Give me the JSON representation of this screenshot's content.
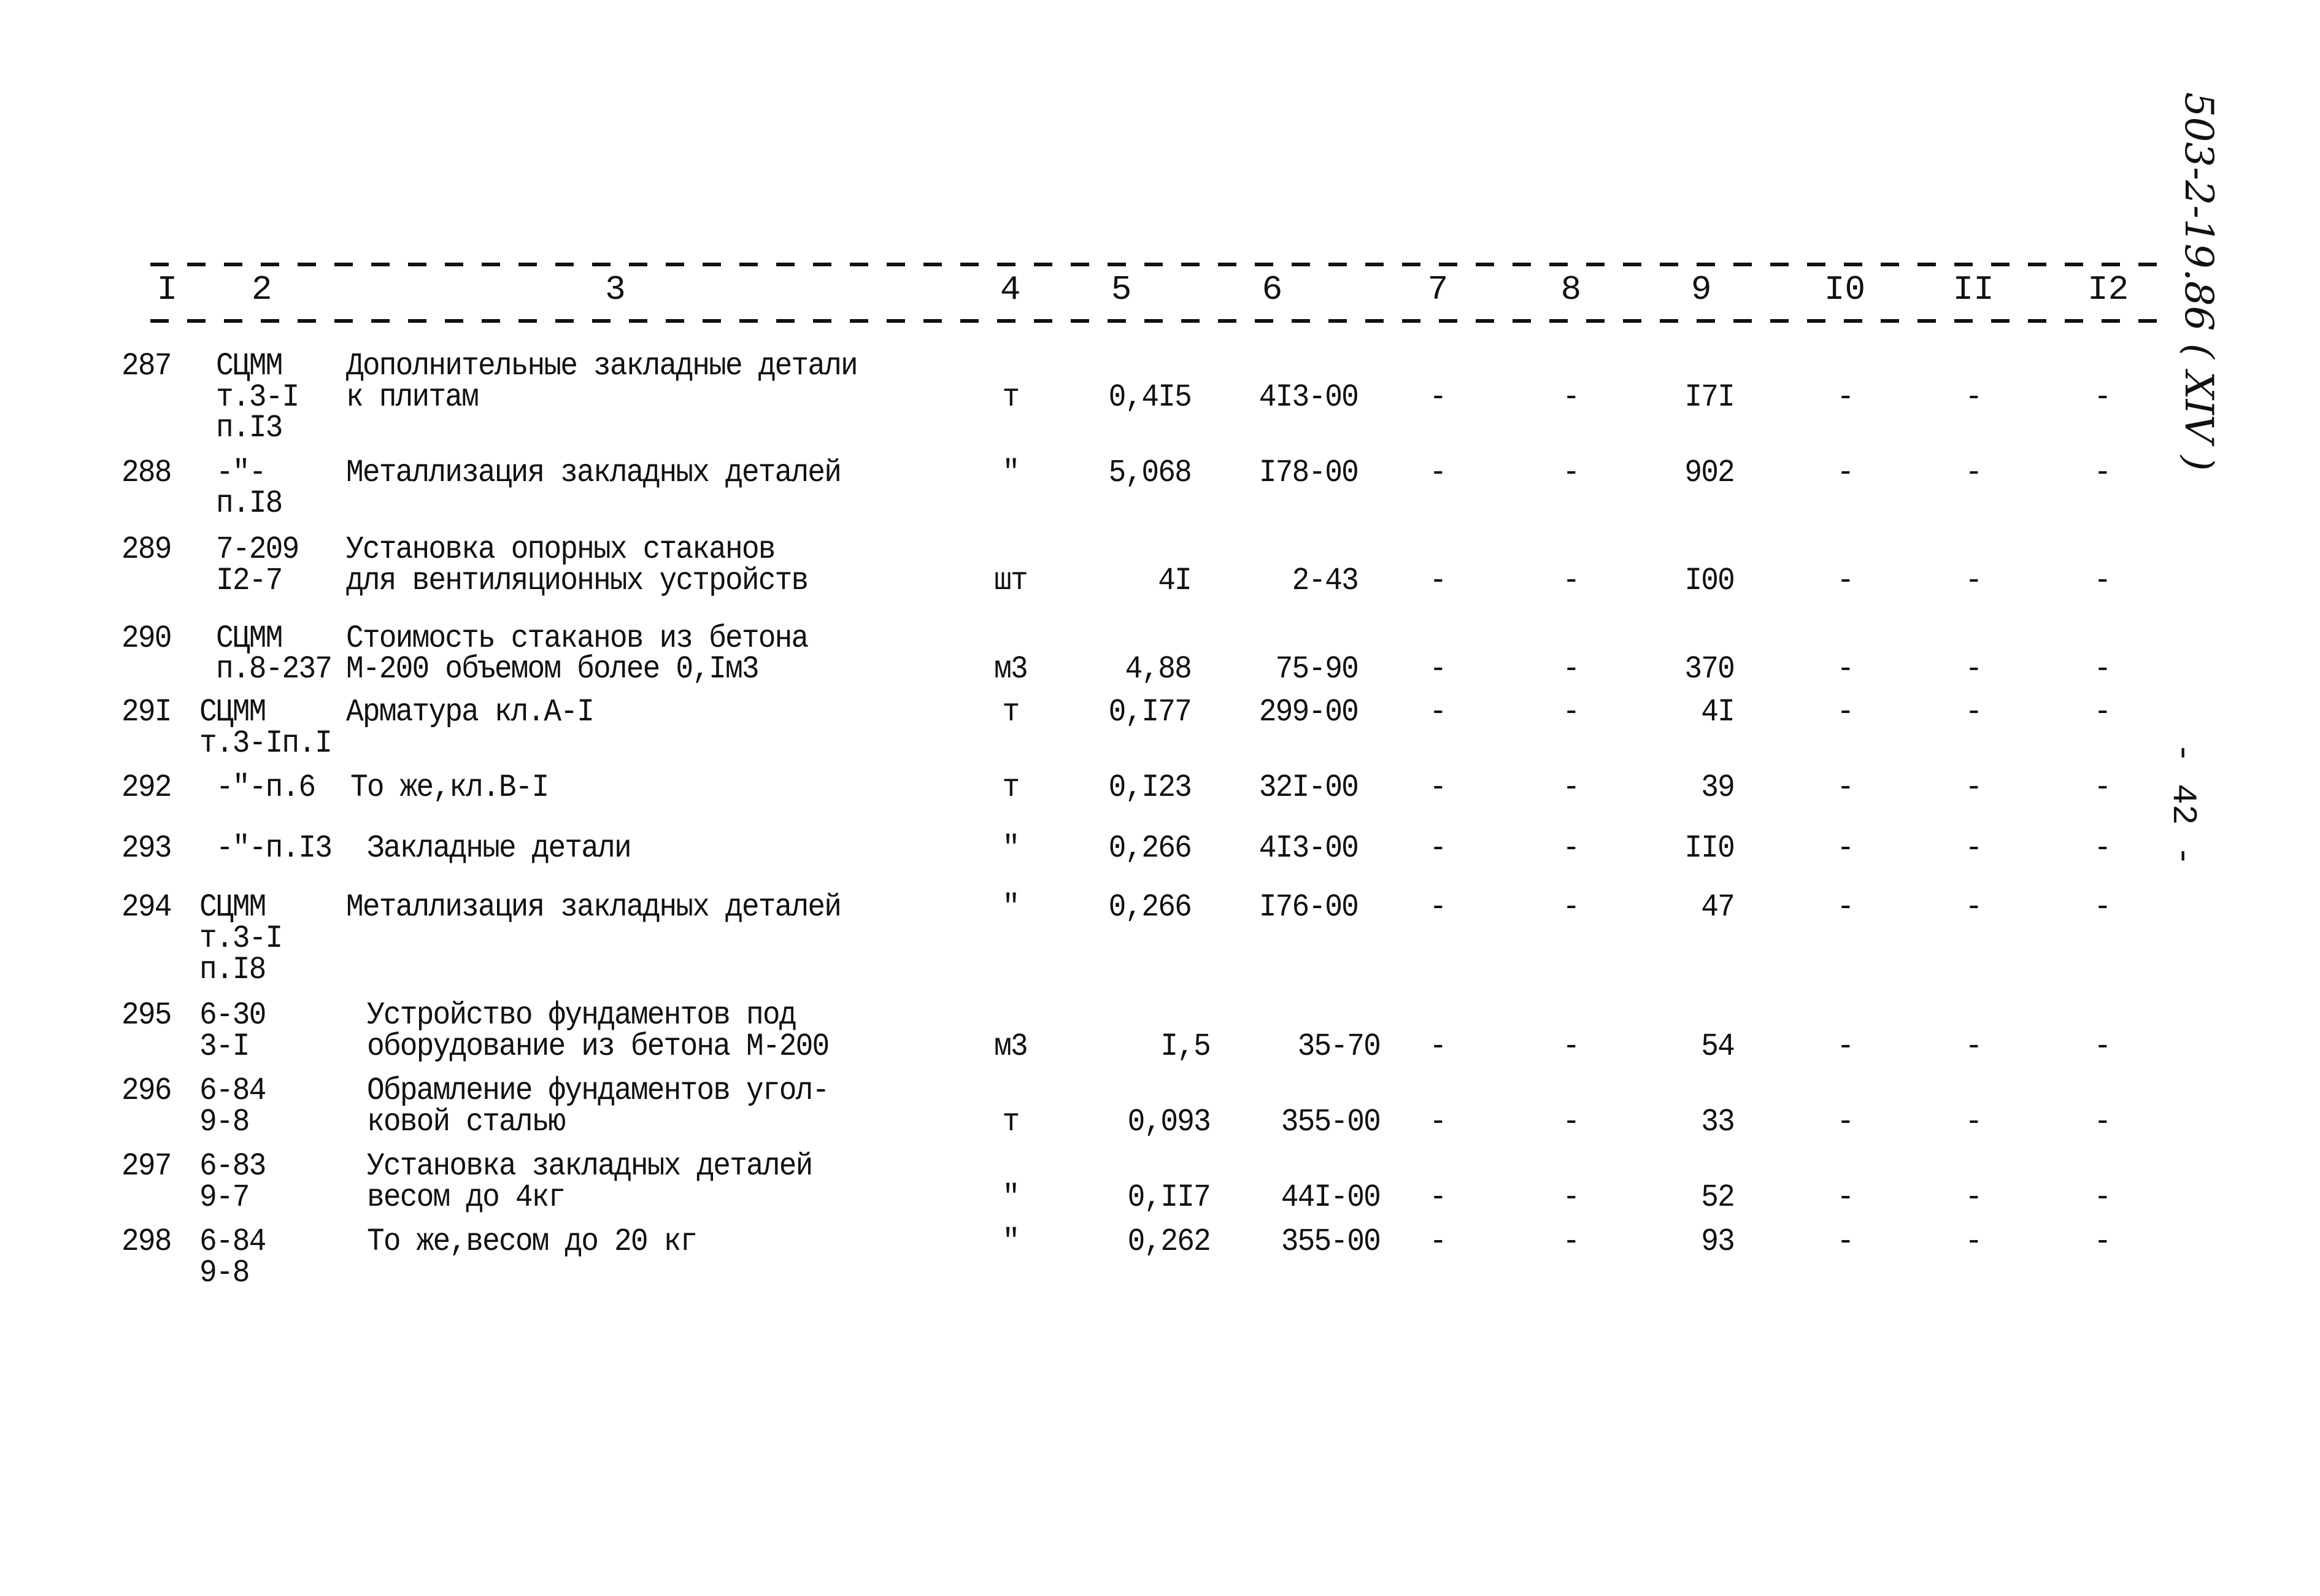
{
  "header": {
    "columns": [
      "I",
      "2",
      "3",
      "4",
      "5",
      "6",
      "7",
      "8",
      "9",
      "I0",
      "II",
      "I2"
    ]
  },
  "rows": [
    {
      "no": "287",
      "code": [
        "СЦММ",
        "т.3-I",
        "п.I3"
      ],
      "desc": [
        "Дополнительные закладные детали",
        "к плитам"
      ],
      "unit": "т",
      "qty": "0,4I5",
      "price": "4I3-00",
      "c7": "-",
      "c8": "-",
      "c9": "I7I",
      "c10": "-",
      "c11": "-",
      "c12": "-"
    },
    {
      "no": "288",
      "code": [
        "-\"-",
        "п.I8"
      ],
      "desc": [
        "Металлизация закладных деталей"
      ],
      "unit": "\"",
      "qty": "5,068",
      "price": "I78-00",
      "c7": "-",
      "c8": "-",
      "c9": "902",
      "c10": "-",
      "c11": "-",
      "c12": "-"
    },
    {
      "no": "289",
      "code": [
        "7-209",
        "I2-7"
      ],
      "desc": [
        "Установка опорных стаканов",
        "для вентиляционных устройств"
      ],
      "unit": "шт",
      "qty": "4I",
      "price": "2-43",
      "c7": "-",
      "c8": "-",
      "c9": "I00",
      "c10": "-",
      "c11": "-",
      "c12": "-"
    },
    {
      "no": "290",
      "code": [
        "СЦММ",
        "п.8-237"
      ],
      "desc": [
        "Стоимость стаканов из бетона",
        "М-200 объемом более 0,Iм3"
      ],
      "unit": "м3",
      "qty": "4,88",
      "price": "75-90",
      "c7": "-",
      "c8": "-",
      "c9": "370",
      "c10": "-",
      "c11": "-",
      "c12": "-"
    },
    {
      "no": "29I",
      "code": [
        "СЦММ",
        "т.3-Iп.I"
      ],
      "desc": [
        "Арматура кл.А-I"
      ],
      "unit": "т",
      "qty": "0,I77",
      "price": "299-00",
      "c7": "-",
      "c8": "-",
      "c9": "4I",
      "c10": "-",
      "c11": "-",
      "c12": "-"
    },
    {
      "no": "292",
      "code": [
        "-\"-п.6"
      ],
      "desc": [
        "То же,кл.В-I"
      ],
      "unit": "т",
      "qty": "0,I23",
      "price": "32I-00",
      "c7": "-",
      "c8": "-",
      "c9": "39",
      "c10": "-",
      "c11": "-",
      "c12": "-"
    },
    {
      "no": "293",
      "code": [
        "-\"-п.I3"
      ],
      "desc": [
        "Закладные детали"
      ],
      "unit": "\"",
      "qty": "0,266",
      "price": "4I3-00",
      "c7": "-",
      "c8": "-",
      "c9": "II0",
      "c10": "-",
      "c11": "-",
      "c12": "-"
    },
    {
      "no": "294",
      "code": [
        "СЦММ",
        "т.3-I",
        "п.I8"
      ],
      "desc": [
        "Металлизация закладных деталей"
      ],
      "unit": "\"",
      "qty": "0,266",
      "price": "I76-00",
      "c7": "-",
      "c8": "-",
      "c9": "47",
      "c10": "-",
      "c11": "-",
      "c12": "-"
    },
    {
      "no": "295",
      "code": [
        "6-30",
        "3-I"
      ],
      "desc": [
        "Устройство фундаментов под",
        "оборудование из бетона М-200"
      ],
      "unit": "м3",
      "qty": "I,5",
      "price": "35-70",
      "c7": "-",
      "c8": "-",
      "c9": "54",
      "c10": "-",
      "c11": "-",
      "c12": "-"
    },
    {
      "no": "296",
      "code": [
        "6-84",
        "9-8"
      ],
      "desc": [
        "Обрамление фундаментов угол-",
        "ковой сталью"
      ],
      "unit": "т",
      "qty": "0,093",
      "price": "355-00",
      "c7": "-",
      "c8": "-",
      "c9": "33",
      "c10": "-",
      "c11": "-",
      "c12": "-"
    },
    {
      "no": "297",
      "code": [
        "6-83",
        "9-7"
      ],
      "desc": [
        "Установка закладных деталей",
        "весом до 4кг"
      ],
      "unit": "\"",
      "qty": "0,II7",
      "price": "44I-00",
      "c7": "-",
      "c8": "-",
      "c9": "52",
      "c10": "-",
      "c11": "-",
      "c12": "-"
    },
    {
      "no": "298",
      "code": [
        "6-84",
        "9-8"
      ],
      "desc": [
        "То же,весом до 20 кг"
      ],
      "unit": "\"",
      "qty": "0,262",
      "price": "355-00",
      "c7": "-",
      "c8": "-",
      "c9": "93",
      "c10": "-",
      "c11": "-",
      "c12": "-"
    }
  ],
  "margin": {
    "document_code": "503-2-19.86 ( XIV )",
    "page_number": "- 42 -"
  }
}
